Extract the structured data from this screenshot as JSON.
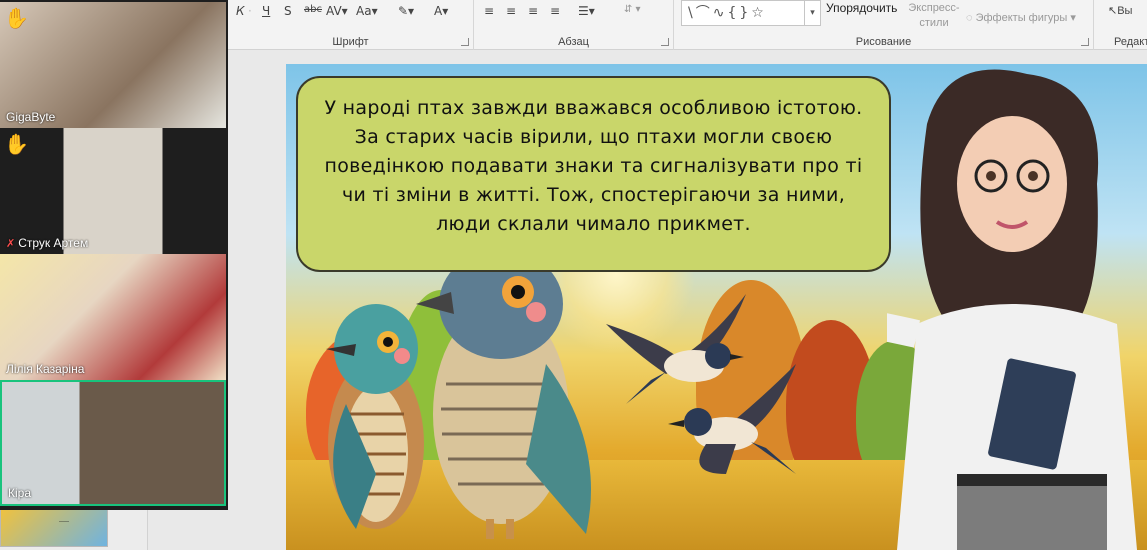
{
  "ribbon": {
    "font_group_label": "Шрифт",
    "paragraph_group_label": "Абзац",
    "drawing_group_label": "Рисование",
    "editing_group_label": "Редакт",
    "arrange_label": "Упорядочить",
    "quick_styles_label": "Экспресс-\nстили",
    "shape_effects_label": "Эффекты фигуры",
    "select_label": "Вы"
  },
  "video_call": {
    "participants": [
      {
        "name": "GigaByte",
        "hand_raised": true,
        "muted": false,
        "active": false
      },
      {
        "name": "Струк Артем",
        "hand_raised": true,
        "muted": true,
        "active": false
      },
      {
        "name": "Лілія Казаріна",
        "hand_raised": false,
        "muted": false,
        "active": false
      },
      {
        "name": "Кіра",
        "hand_raised": false,
        "muted": false,
        "active": true
      }
    ],
    "active_color": "#19c37d"
  },
  "slide": {
    "text": "У народі птах завжди вважався особливою істотою. За старих часів вірили, що птахи могли своєю поведінкою подавати знаки та сигналізувати про ті чи ті зміни в житті. Тож, спостерігаючи за ними, люди склали чимало прикмет.",
    "bubble_color": "#c9d66a"
  },
  "thumbnail": {
    "small_text": "-----"
  },
  "icons": {
    "hand": "raised-hand-icon",
    "mic_off": "mic-off-icon"
  }
}
